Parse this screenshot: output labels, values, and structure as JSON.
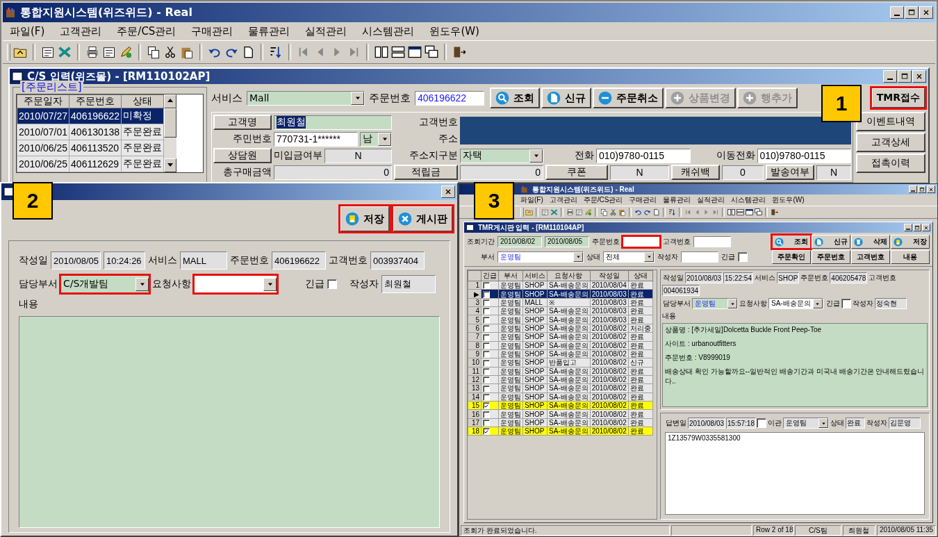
{
  "main_window": {
    "title": "통합지원시스템(위즈위드) - Real",
    "menu": [
      "파일(F)",
      "고객관리",
      "주문/CS관리",
      "구매관리",
      "물류관리",
      "실적관리",
      "시스템관리",
      "윈도우(W)"
    ]
  },
  "cs_window": {
    "title": "C/S 입력(위즈몰) - [RM110102AP]",
    "order_list": {
      "title": "[주문리스트]",
      "columns": [
        "주문일자",
        "주문번호",
        "상태"
      ],
      "rows": [
        {
          "cells": [
            "2010/07/27",
            "406196622",
            "미확정"
          ],
          "selected": true
        },
        {
          "cells": [
            "2010/07/01",
            "406130138",
            "주문완료"
          ],
          "selected": false
        },
        {
          "cells": [
            "2010/06/25",
            "406113520",
            "주문완료"
          ],
          "selected": false
        },
        {
          "cells": [
            "2010/06/25",
            "406112629",
            "주문완료"
          ],
          "selected": false
        }
      ]
    },
    "service": {
      "label": "서비스",
      "value": "Mall"
    },
    "order_no": {
      "label": "주문번호",
      "value": "406196622"
    },
    "buttons": [
      {
        "label": "조회",
        "kind": "search",
        "disabled": false,
        "outlined": false
      },
      {
        "label": "신규",
        "kind": "new",
        "disabled": false,
        "outlined": false
      },
      {
        "label": "주문취소",
        "kind": "cancel",
        "disabled": false,
        "outlined": false
      },
      {
        "label": "상품변경",
        "kind": "add",
        "disabled": true,
        "outlined": false
      },
      {
        "label": "행추가",
        "kind": "add",
        "disabled": true,
        "outlined": false
      },
      {
        "label": "TMR접수",
        "kind": "text",
        "disabled": false,
        "outlined": true
      }
    ],
    "customer": {
      "name_button": "고객명",
      "name": {
        "value": "최원철",
        "selected": true
      },
      "customer_no_label": "고객번호",
      "ssn_label": "주민번호",
      "ssn": "770731-1******",
      "gender": "남",
      "address_label": "주소",
      "agent_button": "상담원",
      "unpaid_label": "미입금여부",
      "unpaid": "N",
      "address_type_label": "주소지구분",
      "address_type": "자택",
      "phone_label": "전화",
      "phone": "010)9780-0115",
      "mobile_label": "이동전화",
      "mobile": "010)9780-0115",
      "total_label": "총구매금액",
      "total": "0",
      "points_button": "적립금",
      "points": "0",
      "coupon_button": "쿠폰",
      "coupon": "N",
      "cashback_button": "캐쉬백",
      "cashback": "0",
      "sent_label": "발송여부",
      "sent": "N"
    },
    "side_buttons": [
      "이벤트내역",
      "고객상세",
      "접촉이력"
    ]
  },
  "board_popup": {
    "buttons": [
      {
        "label": "저장",
        "kind": "save",
        "outlined": true
      },
      {
        "label": "게시판",
        "kind": "close",
        "outlined": true
      }
    ],
    "written_label": "작성일",
    "written_date": "2010/08/05",
    "written_time": "10:24:26",
    "service_label": "서비스",
    "service": "MALL",
    "order_no_label": "주문번호",
    "order_no": "406196622",
    "customer_no_label": "고객번호",
    "customer_no": "003937404",
    "dept_label": "담당부서",
    "dept": {
      "value": "C/S개발팀",
      "outlined": true
    },
    "request_label": "요청사항",
    "request": {
      "outlined": true
    },
    "urgent_label": "긴급",
    "urgent": false,
    "writer_label": "작성자",
    "writer": "최원철",
    "content_label": "내용"
  },
  "tmr_window": {
    "title": "통합지원시스템(위즈위드) - Real",
    "menu": [
      "파일(F)",
      "고객관리",
      "주문/CS관리",
      "구매관리",
      "물류관리",
      "실적관리",
      "시스템관리",
      "윈도우(W)"
    ],
    "inner_title": "TMR게시판 입력 - [RM110104AP]",
    "filters": {
      "period_label": "조회기간",
      "period_from": "2010/08/02",
      "period_to": "2010/08/05",
      "order_no_label": "주문번호",
      "order_no_outlined": true,
      "customer_no_label": "고객번호",
      "dept_label": "부서",
      "dept": "운영팀",
      "status_label": "상태",
      "status": "전체",
      "writer_label": "작성자",
      "urgent_label": "긴급",
      "urgent": false
    },
    "buttons": [
      {
        "label": "조회",
        "kind": "search",
        "outlined": true
      },
      {
        "label": "신규",
        "kind": "new",
        "outlined": false
      },
      {
        "label": "삭제",
        "kind": "delete",
        "outlined": false
      },
      {
        "label": "저장",
        "kind": "save",
        "outlined": false
      }
    ],
    "sort_buttons": [
      "주문확인",
      "주문번호",
      "고객번호",
      "내용"
    ],
    "grid": {
      "urgent_column": "긴급",
      "columns": [
        "부서",
        "서비스",
        "요청사항",
        "작성일",
        "상태"
      ],
      "rows": [
        {
          "no": "1",
          "urgent": false,
          "selected": false,
          "cells": [
            "운영팀",
            "SHOP",
            "SA-배송문의",
            "2010/08/04",
            "완료"
          ]
        },
        {
          "no": "▶",
          "urgent": false,
          "selected": true,
          "cells": [
            "운영팀",
            "SHOP",
            "SA-배송문의",
            "2010/08/03",
            "완료"
          ]
        },
        {
          "no": "3",
          "urgent": false,
          "selected": false,
          "cells": [
            "운영팀",
            "MALL",
            "※",
            "2010/08/03",
            "완료"
          ]
        },
        {
          "no": "4",
          "urgent": false,
          "selected": false,
          "cells": [
            "운영팀",
            "SHOP",
            "SA-배송문의",
            "2010/08/03",
            "완료"
          ]
        },
        {
          "no": "5",
          "urgent": false,
          "selected": false,
          "cells": [
            "운영팀",
            "SHOP",
            "SA-배송문의",
            "2010/08/03",
            "완료"
          ]
        },
        {
          "no": "6",
          "urgent": false,
          "selected": false,
          "cells": [
            "운영팀",
            "SHOP",
            "SA-배송문의",
            "2010/08/02",
            "처리중"
          ]
        },
        {
          "no": "7",
          "urgent": false,
          "selected": false,
          "cells": [
            "운영팀",
            "SHOP",
            "SA-배송문의",
            "2010/08/02",
            "완료"
          ]
        },
        {
          "no": "8",
          "urgent": false,
          "selected": false,
          "cells": [
            "운영팀",
            "SHOP",
            "SA-배송문의",
            "2010/08/02",
            "완료"
          ]
        },
        {
          "no": "9",
          "urgent": false,
          "selected": false,
          "cells": [
            "운영팀",
            "SHOP",
            "SA-배송문의",
            "2010/08/02",
            "완료"
          ]
        },
        {
          "no": "10",
          "urgent": false,
          "selected": false,
          "cells": [
            "운영팀",
            "SHOP",
            "반품입고",
            "2010/08/02",
            "신규"
          ]
        },
        {
          "no": "11",
          "urgent": false,
          "selected": false,
          "cells": [
            "운영팀",
            "SHOP",
            "SA-배송문의",
            "2010/08/02",
            "완료"
          ]
        },
        {
          "no": "12",
          "urgent": false,
          "selected": false,
          "cells": [
            "운영팀",
            "SHOP",
            "SA-배송문의",
            "2010/08/02",
            "완료"
          ]
        },
        {
          "no": "13",
          "urgent": false,
          "selected": false,
          "cells": [
            "운영팀",
            "SHOP",
            "SA-배송문의",
            "2010/08/02",
            "완료"
          ]
        },
        {
          "no": "14",
          "urgent": false,
          "selected": false,
          "cells": [
            "운영팀",
            "SHOP",
            "SA-배송문의",
            "2010/08/02",
            "완료"
          ]
        },
        {
          "no": "15",
          "urgent": true,
          "selected": false,
          "cells": [
            "운영팀",
            "SHOP",
            "SA-배송문의",
            "2010/08/02",
            "완료"
          ]
        },
        {
          "no": "16",
          "urgent": false,
          "selected": false,
          "cells": [
            "운영팀",
            "SHOP",
            "SA-배송문의",
            "2010/08/02",
            "완료"
          ]
        },
        {
          "no": "17",
          "urgent": false,
          "selected": false,
          "cells": [
            "운영팀",
            "SHOP",
            "SA-배송문의",
            "2010/08/02",
            "완료"
          ]
        },
        {
          "no": "18",
          "urgent": true,
          "selected": false,
          "cells": [
            "운영팀",
            "SHOP",
            "SA-배송문의",
            "2010/08/02",
            "완료"
          ]
        }
      ]
    },
    "detail": {
      "written_label": "작성일",
      "written_date": "2010/08/03",
      "written_time": "15:22:54",
      "service_label": "서비스",
      "service": "SHOP",
      "order_no_label": "주문번호",
      "order_no": "406205478",
      "customer_no_label": "고객번호",
      "customer_no": "004061934",
      "dept_label": "담당부서",
      "dept": "운영팀",
      "request_label": "요청사항",
      "request": "SA-배송문의",
      "urgent_label": "긴급",
      "urgent": false,
      "writer_label": "작성자",
      "writer": "정숙현",
      "content_label": "내용",
      "content_lines": [
        "상품명 : [추가세일]Dolcetta Buckle Front Peep-Toe",
        "사이트 : urbanoutfitters",
        "주문번호 : V8999019",
        "배송상태 확인 가능할까요--일반적인 배송기간과 미국내 배송기간은 안내해드렸습니다.."
      ]
    },
    "answer": {
      "date_label": "답변일",
      "date": "2010/08/03",
      "time": "15:57:18",
      "transfer_label": "이관",
      "transfer": false,
      "dept": "운영팀",
      "status_label": "상태",
      "status": "완료",
      "writer_label": "작성자",
      "writer": "김문영",
      "text": "1Z13579W0335581300"
    },
    "status_bar": [
      "조회가 완료되었습니다.",
      "Row 2 of 18",
      "C/S팀",
      "최원철",
      "2010/08/05 11:35"
    ]
  },
  "callouts": [
    "1",
    "2",
    "3"
  ]
}
